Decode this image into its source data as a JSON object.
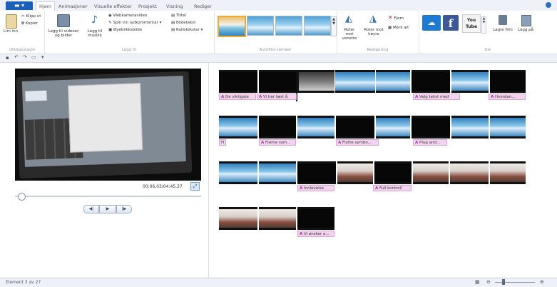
{
  "tabs": {
    "file_label": "",
    "items": [
      "Hjem",
      "Animasjoner",
      "Visuelle effekter",
      "Prosjekt",
      "Visning",
      "Rediger"
    ]
  },
  "ribbon": {
    "clipboard": {
      "paste": "Lim inn",
      "cut": "Klipp ut",
      "copy": "Kopier",
      "group": "Utklippstavle"
    },
    "add": {
      "add_videos": "Legg til videoer og bilder",
      "add_music": "Legg til musikk",
      "webcam": "Webkameravideo",
      "record_narration": "Spill inn lydkommentar",
      "snapshot": "Øyeblikksbilde",
      "title": "Tittel",
      "caption": "Bildetekst",
      "credits": "Rulletekster",
      "group": "Legg til"
    },
    "autofilm": {
      "group": "Autofilm-temaer"
    },
    "editing": {
      "rotate_left": "Roter mot venstre",
      "rotate_right": "Roter mot høyre",
      "remove": "Fjern",
      "select_all": "Merk alt",
      "group": "Redigering"
    },
    "share": {
      "youtube": "You Tube",
      "save_movie": "Lagre film",
      "sign_in": "Logg på",
      "group": "Del"
    }
  },
  "preview": {
    "time": "00:06,03/04:45,37"
  },
  "timeline": {
    "row1_captions": [
      "De viktigste",
      "Vi har lært å",
      "Velg tekst med",
      "Hvordan..."
    ],
    "row2_captions": [
      "H",
      "Fjerne sym...",
      "Flytte symbo...",
      "Plug and..."
    ],
    "row3_captions": [
      "Innlevelse",
      "Full kontroll"
    ],
    "row4_captions": [
      "Vi ønsker a..."
    ]
  },
  "status": {
    "element": "Element 3 av 27"
  }
}
